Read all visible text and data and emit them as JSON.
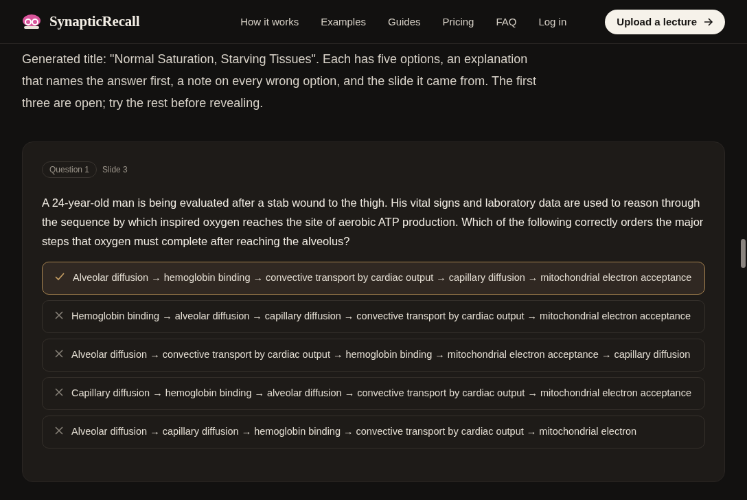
{
  "header": {
    "brand": "SynapticRecall",
    "nav": [
      "How it works",
      "Examples",
      "Guides",
      "Pricing",
      "FAQ",
      "Log in"
    ],
    "cta": "Upload a lecture"
  },
  "intro": "Generated title: \"Normal Saturation, Starving Tissues\". Each has five options, an explanation that names the answer first, a note on every wrong option, and the slide it came from. The first three are open; try the rest before revealing.",
  "question": {
    "number": "Question 1",
    "slide": "Slide 3",
    "stem": "A 24-year-old man is being evaluated after a stab wound to the thigh. His vital signs and laboratory data are used to reason through the sequence by which inspired oxygen reaches the site of aerobic ATP production. Which of the following correctly orders the major steps that oxygen must complete after reaching the alveolus?",
    "options": [
      {
        "text": "Alveolar diffusion → hemoglobin binding → convective transport by cardiac output → capillary diffusion → mitochondrial electron acceptance",
        "correct": true
      },
      {
        "text": "Hemoglobin binding → alveolar diffusion → capillary diffusion → convective transport by cardiac output → mitochondrial electron acceptance",
        "correct": false
      },
      {
        "text": "Alveolar diffusion → convective transport by cardiac output → hemoglobin binding → mitochondrial electron acceptance → capillary diffusion",
        "correct": false
      },
      {
        "text": "Capillary diffusion → hemoglobin binding → alveolar diffusion → convective transport by cardiac output → mitochondrial electron acceptance",
        "correct": false
      },
      {
        "text": "Alveolar diffusion → capillary diffusion → hemoglobin binding → convective transport by cardiac output → mitochondrial electron",
        "correct": false
      }
    ]
  }
}
